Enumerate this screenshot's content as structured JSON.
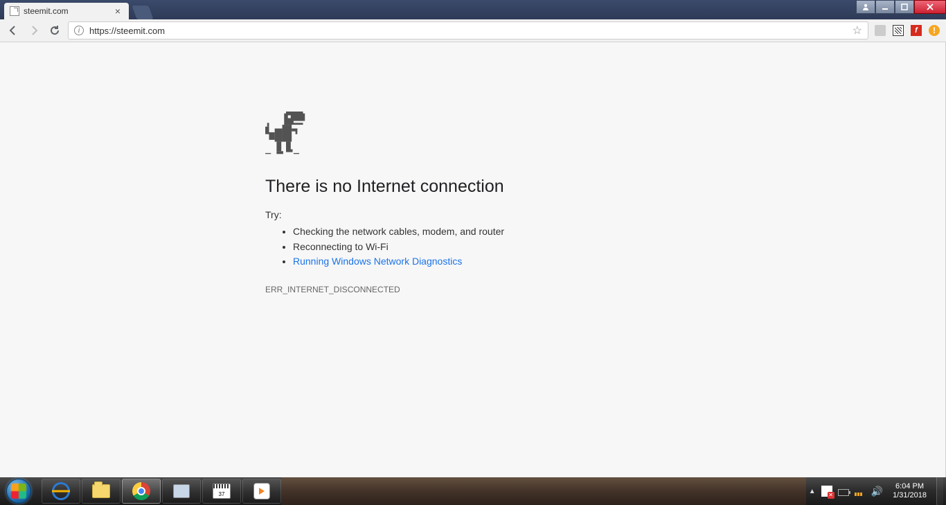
{
  "tab": {
    "title": "steemit.com"
  },
  "toolbar": {
    "url": "https://steemit.com"
  },
  "page": {
    "heading": "There is no Internet connection",
    "try_label": "Try:",
    "suggestions": {
      "s1": "Checking the network cables, modem, and router",
      "s2": "Reconnecting to Wi-Fi",
      "s3": "Running Windows Network Diagnostics"
    },
    "error_code": "ERR_INTERNET_DISCONNECTED"
  },
  "taskbar": {
    "calendar_text": "37",
    "clock_time": "6:04 PM",
    "clock_date": "1/31/2018"
  },
  "ext": {
    "flash_letter": "f",
    "warn_mark": "!"
  }
}
